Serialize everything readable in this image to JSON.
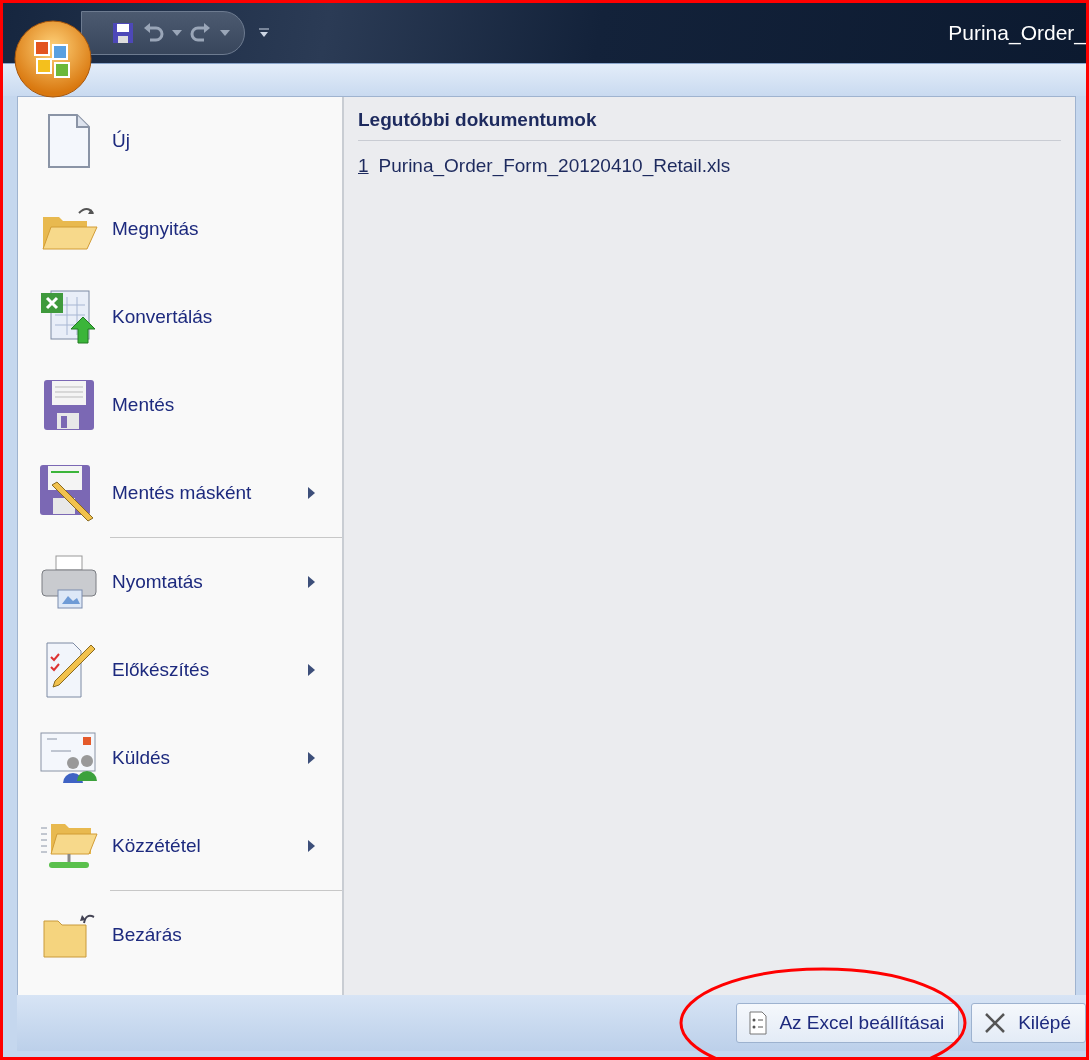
{
  "title_bar": {
    "title": "Purina_Order_"
  },
  "menu": {
    "items": [
      {
        "label": "Új",
        "submenu": false,
        "separator_before": false
      },
      {
        "label": "Megnyitás",
        "submenu": false,
        "separator_before": false
      },
      {
        "label": "Konvertálás",
        "submenu": false,
        "separator_before": false
      },
      {
        "label": "Mentés",
        "submenu": false,
        "separator_before": false
      },
      {
        "label": "Mentés másként",
        "submenu": true,
        "separator_before": false
      },
      {
        "label": "Nyomtatás",
        "submenu": true,
        "separator_before": true
      },
      {
        "label": "Előkészítés",
        "submenu": true,
        "separator_before": false
      },
      {
        "label": "Küldés",
        "submenu": true,
        "separator_before": false
      },
      {
        "label": "Közzététel",
        "submenu": true,
        "separator_before": false
      },
      {
        "label": "Bezárás",
        "submenu": false,
        "separator_before": true
      }
    ]
  },
  "recent": {
    "heading": "Legutóbbi dokumentumok",
    "files": [
      {
        "number": "1",
        "name": "Purina_Order_Form_20120410_Retail.xls"
      }
    ]
  },
  "footer_buttons": [
    {
      "label": "Az Excel beállításai",
      "highlighted": true
    },
    {
      "label": "Kilépé",
      "highlighted": false
    }
  ]
}
